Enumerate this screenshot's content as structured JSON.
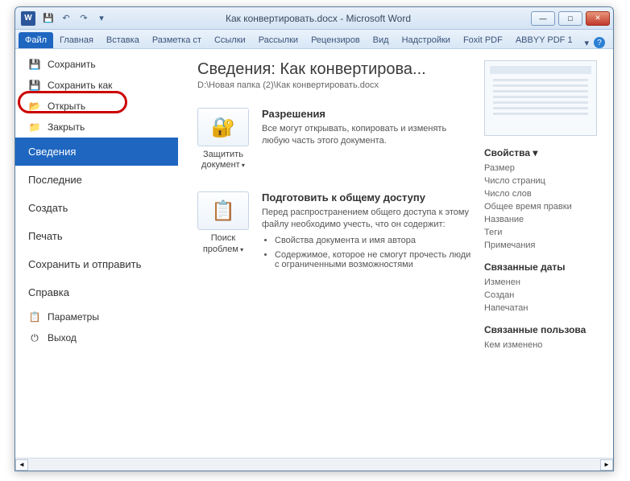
{
  "titlebar": {
    "app_icon_text": "W",
    "title": "Как конвертировать.docx - Microsoft Word"
  },
  "ribbon": {
    "tabs": [
      "Файл",
      "Главная",
      "Вставка",
      "Разметка ст",
      "Ссылки",
      "Рассылки",
      "Рецензиров",
      "Вид",
      "Надстройки",
      "Foxit PDF",
      "ABBYY PDF 1"
    ],
    "active_index": 0,
    "dropdown_glyph": "▾",
    "help_glyph": "?"
  },
  "file_menu": {
    "items": [
      {
        "icon": "💾",
        "label": "Сохранить",
        "kind": "cmd"
      },
      {
        "icon": "💾",
        "label": "Сохранить как",
        "kind": "cmd",
        "highlighted": true
      },
      {
        "icon": "📂",
        "label": "Открыть",
        "kind": "cmd"
      },
      {
        "icon": "📁",
        "label": "Закрыть",
        "kind": "cmd"
      },
      {
        "label": "Сведения",
        "kind": "tab",
        "selected": true
      },
      {
        "label": "Последние",
        "kind": "tab"
      },
      {
        "label": "Создать",
        "kind": "tab"
      },
      {
        "label": "Печать",
        "kind": "tab"
      },
      {
        "label": "Сохранить и отправить",
        "kind": "tab"
      },
      {
        "label": "Справка",
        "kind": "tab"
      },
      {
        "icon": "📋",
        "label": "Параметры",
        "kind": "cmd"
      },
      {
        "icon": "⏻",
        "label": "Выход",
        "kind": "cmd"
      }
    ]
  },
  "info": {
    "title": "Сведения: Как конвертирова...",
    "path": "D:\\Новая папка (2)\\Как конвертировать.docx",
    "permissions": {
      "button_icon": "🔐",
      "button_label": "Защитить документ",
      "heading": "Разрешения",
      "text": "Все могут открывать, копировать и изменять любую часть этого документа."
    },
    "prepare": {
      "button_icon": "📋",
      "button_label": "Поиск проблем",
      "heading": "Подготовить к общему доступу",
      "text": "Перед распространением общего доступа к этому файлу необходимо учесть, что он содержит:",
      "bullets": [
        "Свойства документа и имя автора",
        "Содержимое, которое не смогут прочесть люди с ограниченными возможностями"
      ]
    }
  },
  "properties": {
    "heading": "Свойства ▾",
    "rows": [
      "Размер",
      "Число страниц",
      "Число слов",
      "Общее время правки",
      "Название",
      "Теги",
      "Примечания"
    ],
    "dates_heading": "Связанные даты",
    "dates": [
      "Изменен",
      "Создан",
      "Напечатан"
    ],
    "people_heading": "Связанные пользова",
    "last_heading": "Кем изменено"
  }
}
